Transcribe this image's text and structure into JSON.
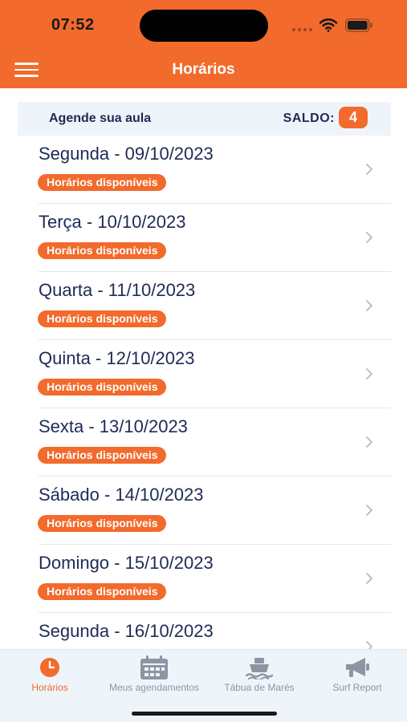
{
  "status_bar": {
    "time": "07:52"
  },
  "header": {
    "title": "Horários",
    "menu_icon": "hamburger-menu-icon",
    "color": "#f26a2c"
  },
  "balance": {
    "label": "Agende sua aula",
    "saldo_label": "SALDO:",
    "saldo_value": "4"
  },
  "days": [
    {
      "title": "Segunda - 09/10/2023",
      "badge": "Horários disponíveis"
    },
    {
      "title": "Terça - 10/10/2023",
      "badge": "Horários disponíveis"
    },
    {
      "title": "Quarta - 11/10/2023",
      "badge": "Horários disponíveis"
    },
    {
      "title": "Quinta - 12/10/2023",
      "badge": "Horários disponíveis"
    },
    {
      "title": "Sexta - 13/10/2023",
      "badge": "Horários disponíveis"
    },
    {
      "title": "Sábado - 14/10/2023",
      "badge": "Horários disponíveis"
    },
    {
      "title": "Domingo - 15/10/2023",
      "badge": "Horários disponíveis"
    },
    {
      "title": "Segunda - 16/10/2023",
      "badge": ""
    }
  ],
  "tabs": [
    {
      "label": "Horários",
      "icon": "clock-icon",
      "active": true
    },
    {
      "label": "Meus agendamentos",
      "icon": "calendar-icon",
      "active": false
    },
    {
      "label": "Tábua de Marés",
      "icon": "boat-icon",
      "active": false
    },
    {
      "label": "Surf Report",
      "icon": "megaphone-icon",
      "active": false
    }
  ],
  "colors": {
    "accent": "#f26a2c",
    "text_primary": "#1f2a55",
    "tab_inactive": "#8c96a3",
    "balance_bg": "#eef4fa"
  }
}
